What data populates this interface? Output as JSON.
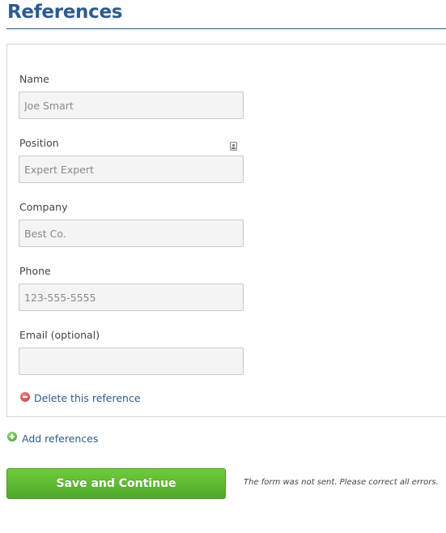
{
  "page": {
    "title": "References"
  },
  "colors": {
    "accent": "#2d5a8f",
    "save_button": "#5cb531",
    "delete_icon": "#d33",
    "add_icon": "#4aa832"
  },
  "reference_form": {
    "fields": [
      {
        "label": "Name",
        "placeholder": "Joe Smart",
        "value": ""
      },
      {
        "label": "Position",
        "placeholder": "Expert Expert",
        "value": ""
      },
      {
        "label": "Company",
        "placeholder": "Best Co.",
        "value": ""
      },
      {
        "label": "Phone",
        "placeholder": "123-555-5555",
        "value": ""
      },
      {
        "label": "Email (optional)",
        "placeholder": "",
        "value": ""
      }
    ],
    "delete_label": "Delete this reference"
  },
  "actions": {
    "add_label": "Add references",
    "save_label": "Save and Continue",
    "error_message": "The form was not sent. Please correct all errors."
  },
  "icons": {
    "name_field": "contact-card-icon",
    "delete": "minus-circle-icon",
    "add": "plus-circle-icon"
  }
}
